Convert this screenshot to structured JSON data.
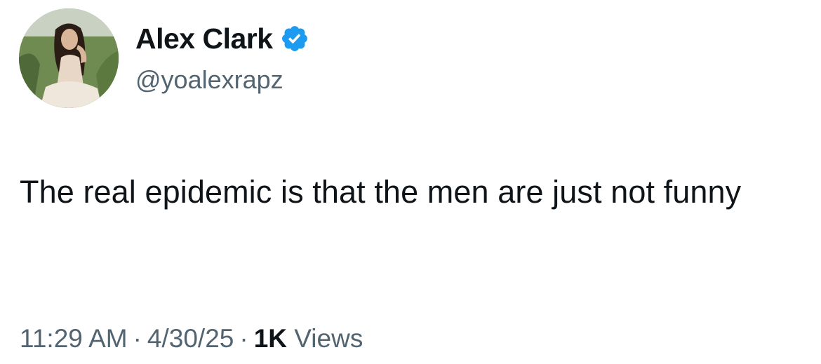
{
  "author": {
    "display_name": "Alex Clark",
    "handle": "@yoalexrapz",
    "verified": true,
    "verified_color": "#1d9bf0"
  },
  "tweet": {
    "text": "The real epidemic is that the men are just not funny"
  },
  "meta": {
    "time": "11:29 AM",
    "separator": "·",
    "date": "4/30/25",
    "views_count": "1K",
    "views_label": "Views"
  },
  "colors": {
    "text_primary": "#0f1419",
    "text_secondary": "#536471",
    "background": "#ffffff"
  }
}
